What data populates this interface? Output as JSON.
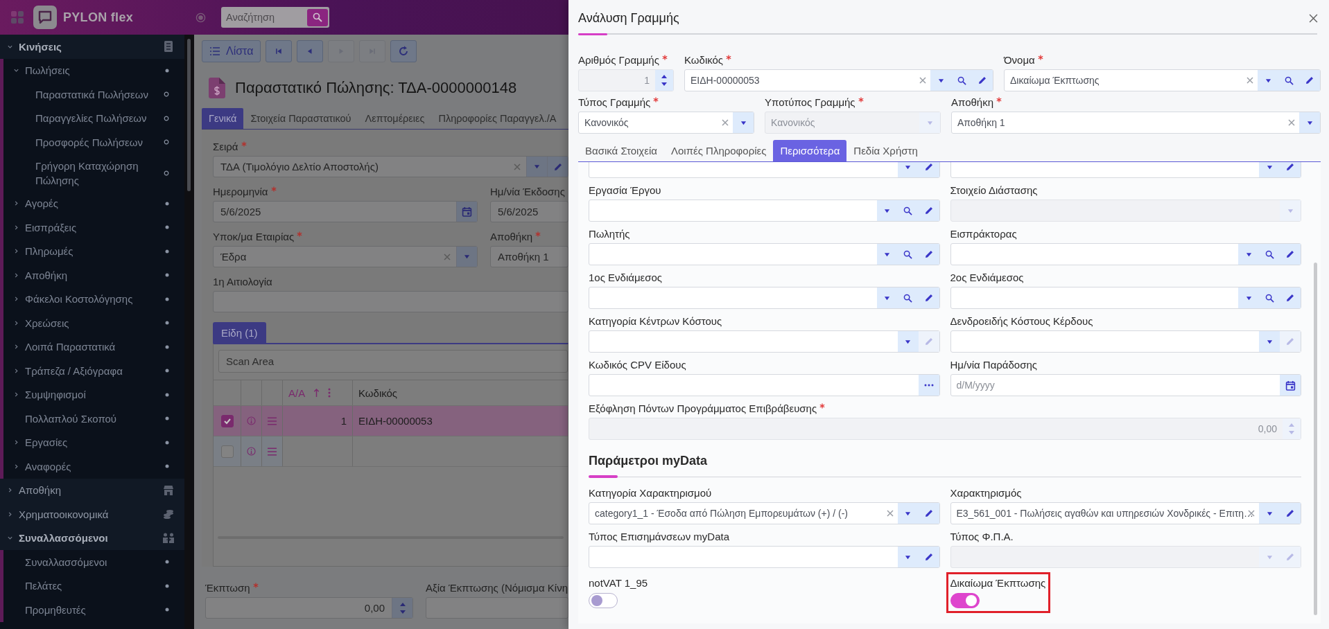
{
  "topbar": {
    "brand": "PYLON flex",
    "search": {
      "placeholder": "Αναζήτηση"
    }
  },
  "sidebar": {
    "sections": [
      {
        "label": "Κινήσεις",
        "expanded": true,
        "children": [
          {
            "label": "Πωλήσεις",
            "kind": "group",
            "expanded": true,
            "children": [
              {
                "label": "Παραστατικά Πωλήσεων"
              },
              {
                "label": "Παραγγελίες Πωλήσεων"
              },
              {
                "label": "Προσφορές Πωλήσεων"
              },
              {
                "label": "Γρήγορη Καταχώρηση Πώλησης"
              }
            ]
          },
          {
            "label": "Αγορές",
            "kind": "group",
            "expanded": false
          },
          {
            "label": "Εισπράξεις",
            "kind": "group",
            "expanded": false
          },
          {
            "label": "Πληρωμές",
            "kind": "group",
            "expanded": false
          },
          {
            "label": "Αποθήκη",
            "kind": "group",
            "expanded": false
          },
          {
            "label": "Φάκελοι Κοστολόγησης",
            "kind": "group",
            "expanded": false
          },
          {
            "label": "Χρεώσεις",
            "kind": "group",
            "expanded": false
          },
          {
            "label": "Λοιπά Παραστατικά",
            "kind": "group",
            "expanded": false
          },
          {
            "label": "Τράπεζα / Αξιόγραφα",
            "kind": "group",
            "expanded": false
          },
          {
            "label": "Συμψηφισμοί",
            "kind": "group",
            "expanded": false
          },
          {
            "label": "Πολλαπλού Σκοπού",
            "kind": "link"
          },
          {
            "label": "Εργασίες",
            "kind": "group",
            "expanded": false
          },
          {
            "label": "Αναφορές",
            "kind": "group",
            "expanded": false
          }
        ]
      },
      {
        "label": "Αποθήκη",
        "expanded": false
      },
      {
        "label": "Χρηματοοικονομικά",
        "expanded": false
      },
      {
        "label": "Συναλλασσόμενοι",
        "expanded": true,
        "children": [
          {
            "label": "Συναλλασσόμενοι",
            "kind": "link"
          },
          {
            "label": "Πελάτες",
            "kind": "link"
          },
          {
            "label": "Προμηθευτές",
            "kind": "link"
          }
        ]
      }
    ]
  },
  "toolbar": [
    {
      "kind": "list",
      "label": "Λίστα",
      "disabled": false
    },
    {
      "kind": "first",
      "disabled": false
    },
    {
      "kind": "prev",
      "disabled": false
    },
    {
      "kind": "next",
      "disabled": true
    },
    {
      "kind": "last",
      "disabled": true
    },
    {
      "kind": "refresh",
      "disabled": false
    }
  ],
  "document": {
    "title": "Παραστατικό Πώλησης: ΤΔΑ-0000000148",
    "tabs": [
      {
        "label": "Γενικά",
        "selected": true
      },
      {
        "label": "Στοιχεία Παραστατικού",
        "selected": false
      },
      {
        "label": "Λεπτομέρειες",
        "selected": false
      },
      {
        "label": "Πληροφορίες Παραγγελ./Α",
        "selected": false
      }
    ],
    "rows": [
      [
        {
          "label": "Σειρά",
          "required": true,
          "value": "ΤΔΑ (Τιμολόγιο Δελτίο Αποστολής)",
          "disabled": false,
          "actions": [
            {
              "kind": "clear",
              "disabled": false
            },
            {
              "kind": "dropdown",
              "disabled": false
            },
            {
              "kind": "edit",
              "disabled": false
            }
          ]
        }
      ],
      [
        {
          "label": "Ημερομηνία",
          "required": true,
          "value": "5/6/2025",
          "disabled": false,
          "actions": [
            {
              "kind": "calendar",
              "disabled": false
            }
          ]
        },
        {
          "label": "Ημ/νία Έκδοσης",
          "required": false,
          "value": "5/6/2025",
          "disabled": false
        }
      ],
      [
        {
          "label": "Υποκ/μα Εταιρίας",
          "required": true,
          "value": "Έδρα",
          "disabled": false,
          "actions": [
            {
              "kind": "clear",
              "disabled": false
            },
            {
              "kind": "dropdown",
              "disabled": false
            }
          ]
        },
        {
          "label": "Αποθήκη",
          "required": true,
          "value": "Αποθήκη 1",
          "disabled": false
        }
      ],
      [
        {
          "label": "1η Αιτιολογία",
          "required": false,
          "disabled": false
        }
      ]
    ],
    "items_panel": {
      "tab": {
        "label": "Είδη (1)",
        "selected": true
      },
      "scan": {
        "placeholder": "Scan Area"
      },
      "columns": [
        {
          "label": "Α/Α",
          "sorted": true
        },
        {
          "label": "Κωδικός",
          "sorted": false
        }
      ],
      "rows": [
        {
          "checked": true,
          "selected": true,
          "aa": "1",
          "code": "ΕΙΔΗ-00000053"
        },
        {
          "checked": false,
          "selected": false
        }
      ]
    },
    "footer": [
      {
        "label": "Έκπτωση",
        "required": true,
        "value": "0,00",
        "disabled": false,
        "actions": [
          {
            "kind": "spinner",
            "disabled": false
          }
        ]
      },
      {
        "label": "Αξία Έκπτωσης (Νόμισμα Κίνη",
        "required": false,
        "disabled": false
      }
    ]
  },
  "panel": {
    "title": "Ανάλυση Γραμμής",
    "rows": [
      [
        {
          "label": "Αριθμός Γραμμής",
          "required": true,
          "value": "1",
          "disabled": true,
          "actions": [
            {
              "kind": "spinner",
              "disabled": false
            }
          ]
        },
        {
          "label": "Κωδικός",
          "required": true,
          "value": "ΕΙΔΗ-00000053",
          "disabled": false,
          "actions": [
            {
              "kind": "clear",
              "disabled": false
            },
            {
              "kind": "dropdown",
              "disabled": false
            },
            {
              "kind": "search",
              "disabled": false
            },
            {
              "kind": "edit",
              "disabled": false
            }
          ]
        },
        {
          "label": "Όνομα",
          "required": true,
          "value": "Δικαίωμα Έκπτωσης",
          "disabled": false,
          "actions": [
            {
              "kind": "clear",
              "disabled": false
            },
            {
              "kind": "dropdown",
              "disabled": false
            },
            {
              "kind": "search",
              "disabled": false
            },
            {
              "kind": "edit",
              "disabled": false
            }
          ]
        }
      ],
      [
        {
          "label": "Τύπος Γραμμής",
          "required": true,
          "value": "Κανονικός",
          "disabled": false,
          "actions": [
            {
              "kind": "clear",
              "disabled": false
            },
            {
              "kind": "dropdown",
              "disabled": false
            }
          ]
        },
        {
          "label": "Υποτύπος Γραμμής",
          "required": true,
          "value": "Κανονικός",
          "disabled": true,
          "actions": [
            {
              "kind": "dropdown",
              "disabled": true
            }
          ]
        },
        {
          "label": "Αποθήκη",
          "required": true,
          "value": "Αποθήκη 1",
          "disabled": false,
          "actions": [
            {
              "kind": "clear",
              "disabled": false
            },
            {
              "kind": "dropdown",
              "disabled": false
            }
          ]
        }
      ]
    ],
    "tabs": [
      {
        "label": "Βασικά Στοιχεία",
        "selected": false
      },
      {
        "label": "Λοιπές Πληροφορίες",
        "selected": false
      },
      {
        "label": "Περισσότερα",
        "selected": true
      },
      {
        "label": "Πεδία Χρήστη",
        "selected": false
      }
    ],
    "more_rows": [
      [
        {
          "disabled": false,
          "actions": [
            {
              "kind": "dropdown",
              "disabled": false
            },
            {
              "kind": "edit",
              "disabled": false
            }
          ]
        },
        {
          "disabled": false,
          "actions": [
            {
              "kind": "dropdown",
              "disabled": false
            },
            {
              "kind": "edit",
              "disabled": false
            }
          ]
        }
      ],
      [
        {
          "label": "Εργασία Έργου",
          "required": false,
          "disabled": false,
          "actions": [
            {
              "kind": "dropdown",
              "disabled": false
            },
            {
              "kind": "search",
              "disabled": false
            },
            {
              "kind": "edit",
              "disabled": false
            }
          ]
        },
        {
          "label": "Στοιχείο Διάστασης",
          "required": false,
          "disabled": true,
          "actions": [
            {
              "kind": "dropdown",
              "disabled": true
            }
          ]
        }
      ],
      [
        {
          "label": "Πωλητής",
          "required": false,
          "disabled": false,
          "actions": [
            {
              "kind": "dropdown",
              "disabled": false
            },
            {
              "kind": "search",
              "disabled": false
            },
            {
              "kind": "edit",
              "disabled": false
            }
          ]
        },
        {
          "label": "Εισπράκτορας",
          "required": false,
          "disabled": false,
          "actions": [
            {
              "kind": "dropdown",
              "disabled": false
            },
            {
              "kind": "search",
              "disabled": false
            },
            {
              "kind": "edit",
              "disabled": false
            }
          ]
        }
      ],
      [
        {
          "label": "1ος Ενδιάμεσος",
          "required": false,
          "disabled": false,
          "actions": [
            {
              "kind": "dropdown",
              "disabled": false
            },
            {
              "kind": "search",
              "disabled": false
            },
            {
              "kind": "edit",
              "disabled": false
            }
          ]
        },
        {
          "label": "2ος Ενδιάμεσος",
          "required": false,
          "disabled": false,
          "actions": [
            {
              "kind": "dropdown",
              "disabled": false
            },
            {
              "kind": "search",
              "disabled": false
            },
            {
              "kind": "edit",
              "disabled": false
            }
          ]
        }
      ],
      [
        {
          "label": "Κατηγορία Κέντρων Κόστους",
          "required": false,
          "disabled": false,
          "actions": [
            {
              "kind": "dropdown",
              "disabled": false
            },
            {
              "kind": "edit",
              "disabled": true
            }
          ]
        },
        {
          "label": "Δενδροειδής Κόστους Κέρδους",
          "required": false,
          "disabled": false,
          "actions": [
            {
              "kind": "dropdown",
              "disabled": false
            },
            {
              "kind": "edit",
              "disabled": true
            }
          ]
        }
      ],
      [
        {
          "label": "Κωδικός CPV Είδους",
          "required": false,
          "disabled": false,
          "actions": [
            {
              "kind": "dots",
              "disabled": false
            }
          ]
        },
        {
          "label": "Ημ/νία Παράδοσης",
          "required": false,
          "placeholder": "d/M/yyyy",
          "disabled": false,
          "actions": [
            {
              "kind": "calendar",
              "disabled": false
            }
          ]
        }
      ],
      [
        {
          "label": "Εξόφληση Πόντων Προγράμματος Επιβράβευσης",
          "required": true,
          "value": "0,00",
          "disabled": true,
          "actions": [
            {
              "kind": "spinner",
              "disabled": true
            }
          ]
        }
      ]
    ],
    "mydata": {
      "title": "Παράμετροι myData",
      "rows": [
        [
          {
            "label": "Κατηγορία Χαρακτηρισμού",
            "required": false,
            "value": "category1_1 - Έσοδα από Πώληση Εμπορευμάτων (+) / (-)",
            "disabled": false,
            "actions": [
              {
                "kind": "clear",
                "disabled": false
              },
              {
                "kind": "dropdown",
                "disabled": false
              },
              {
                "kind": "edit",
                "disabled": false
              }
            ]
          },
          {
            "label": "Χαρακτηρισμός",
            "required": false,
            "value": "E3_561_001 - Πωλήσεις αγαθών και υπηρεσιών Χονδρικές - Επιτη…",
            "disabled": false,
            "actions": [
              {
                "kind": "clear",
                "disabled": false
              },
              {
                "kind": "dropdown",
                "disabled": false
              },
              {
                "kind": "edit",
                "disabled": false
              }
            ]
          }
        ],
        [
          {
            "label": "Τύπος Επισημάνσεων myData",
            "required": false,
            "disabled": false,
            "actions": [
              {
                "kind": "dropdown",
                "disabled": false
              },
              {
                "kind": "edit",
                "disabled": false
              }
            ]
          },
          {
            "label": "Τύπος Φ.Π.Α.",
            "required": false,
            "disabled": true,
            "actions": [
              {
                "kind": "dropdown",
                "disabled": true
              },
              {
                "kind": "edit",
                "disabled": true
              }
            ]
          }
        ]
      ],
      "toggles": [
        {
          "label": "notVAT 1_95",
          "on": false,
          "highlighted": false
        },
        {
          "label": "Δικαίωμα Έκπτωσης",
          "on": true,
          "highlighted": true
        }
      ]
    }
  }
}
